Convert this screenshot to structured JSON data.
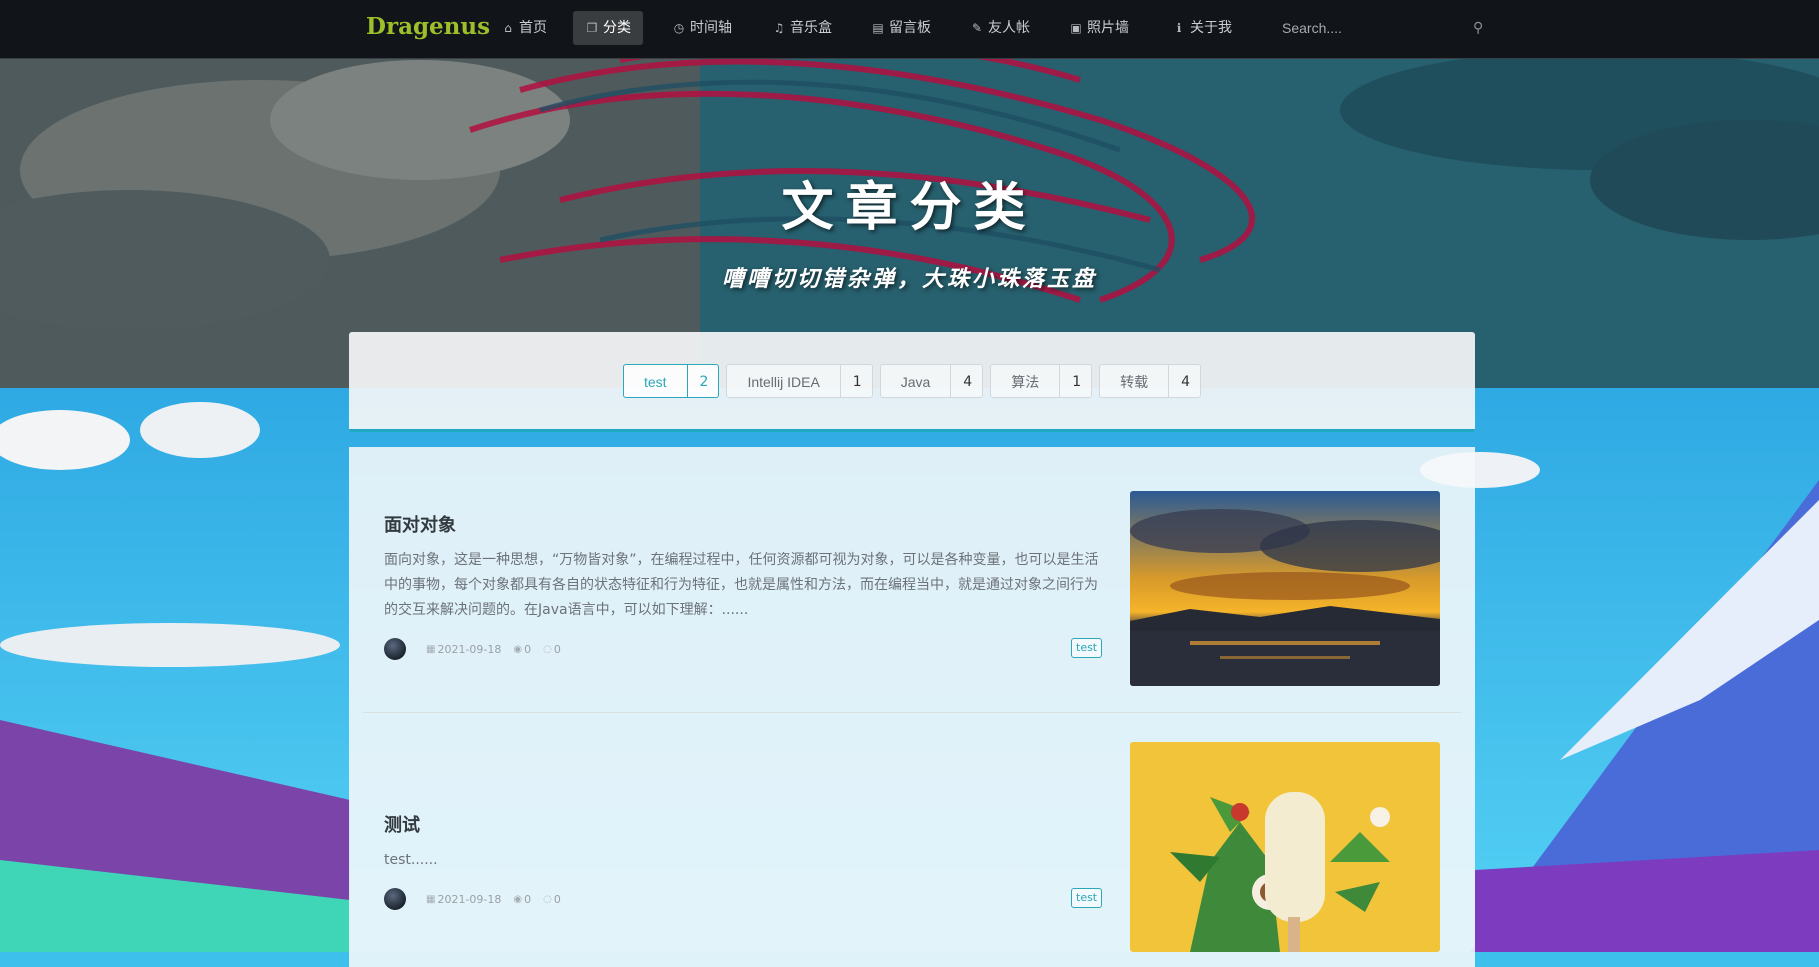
{
  "brand": "Dragenus",
  "nav": [
    {
      "label": "首页",
      "icon": "home-icon",
      "glyph": "⌂"
    },
    {
      "label": "分类",
      "icon": "copy-icon",
      "glyph": "❐",
      "active": true
    },
    {
      "label": "时间轴",
      "icon": "clock-icon",
      "glyph": "◷"
    },
    {
      "label": "音乐盒",
      "icon": "music-icon",
      "glyph": "♫"
    },
    {
      "label": "留言板",
      "icon": "book-icon",
      "glyph": "▤"
    },
    {
      "label": "友人帐",
      "icon": "pencil-icon",
      "glyph": "✎"
    },
    {
      "label": "照片墙",
      "icon": "image-icon",
      "glyph": "▣"
    },
    {
      "label": "关于我",
      "icon": "info-icon",
      "glyph": "ℹ"
    }
  ],
  "search": {
    "placeholder": "Search...."
  },
  "hero": {
    "title": "文章分类",
    "subtitle": "嘈嘈切切错杂弹，大珠小珠落玉盘"
  },
  "categories": [
    {
      "name": "test",
      "count": "2",
      "active": true
    },
    {
      "name": "Intellij IDEA",
      "count": "1"
    },
    {
      "name": "Java",
      "count": "4"
    },
    {
      "name": "算法",
      "count": "1"
    },
    {
      "name": "转载",
      "count": "4"
    }
  ],
  "articles": [
    {
      "title": "面对对象",
      "excerpt": "面向对象，这是一种思想，“万物皆对象”，在编程过程中，任何资源都可视为对象，可以是各种变量，也可以是生活中的事物，每个对象都具有各自的状态特征和行为特征，也就是属性和方法，而在编程当中，就是通过对象之间行为的交互来解决问题的。在Java语言中，可以如下理解：......",
      "date": "2021-09-18",
      "views": "0",
      "comments": "0",
      "tag": "test",
      "image": "sunset-lake-photo"
    },
    {
      "title": "测试",
      "excerpt": "test......",
      "date": "2021-09-18",
      "views": "0",
      "comments": "0",
      "tag": "test",
      "image": "tropical-popsicle-illustration"
    }
  ],
  "colors": {
    "accent": "#2aa8b8",
    "brand": "#9dbf2a",
    "navbar": "#111418"
  }
}
